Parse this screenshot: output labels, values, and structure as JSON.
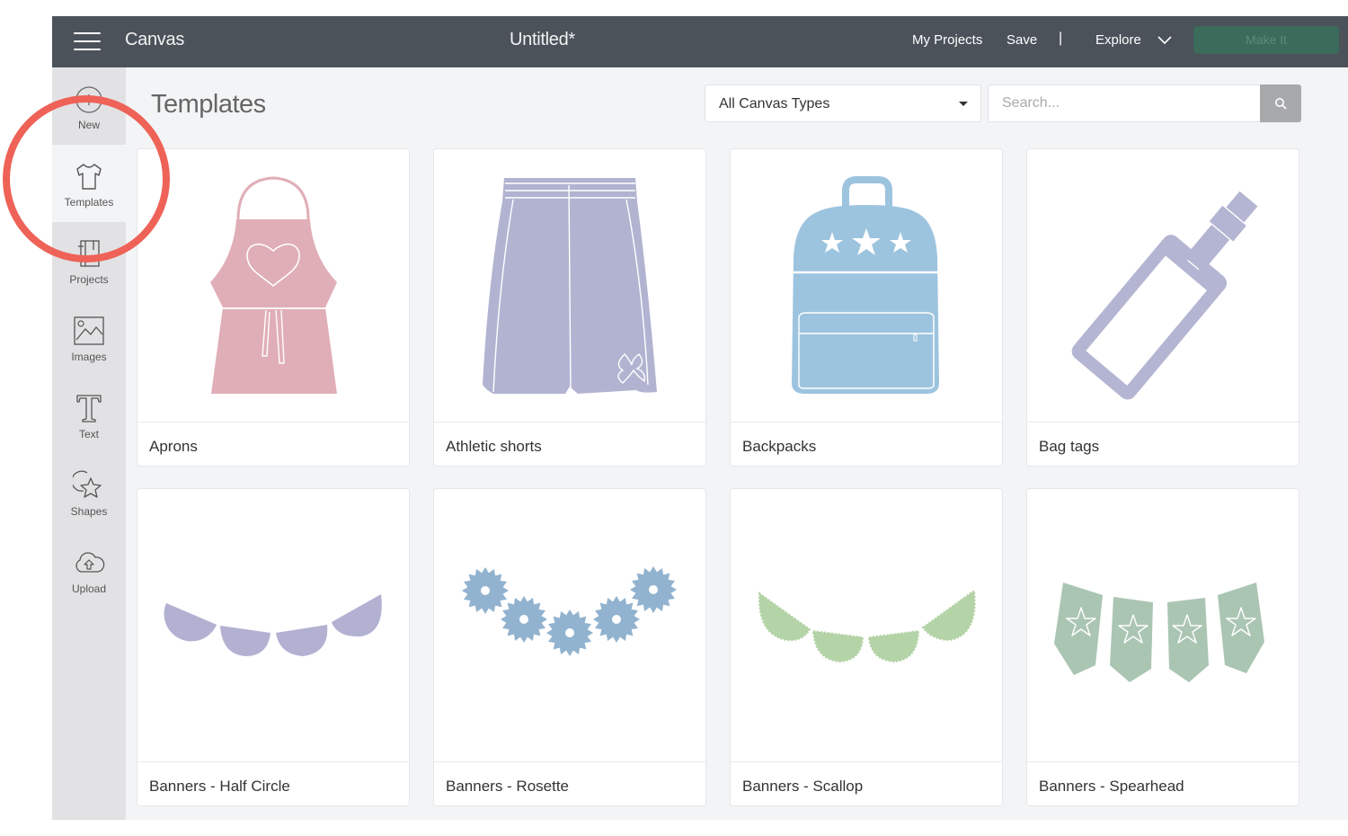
{
  "header": {
    "app_name": "Canvas",
    "document_title": "Untitled*",
    "my_projects_label": "My Projects",
    "save_label": "Save",
    "separator": "|",
    "explore_label": "Explore",
    "make_it_label": "Make It",
    "make_it_color": "#3c6b5b"
  },
  "sidebar": {
    "items": [
      {
        "id": "new",
        "label": "New",
        "icon": "plus-circle-icon",
        "active": false
      },
      {
        "id": "templates",
        "label": "Templates",
        "icon": "tshirt-icon",
        "active": true
      },
      {
        "id": "projects",
        "label": "Projects",
        "icon": "projects-icon",
        "active": false
      },
      {
        "id": "images",
        "label": "Images",
        "icon": "image-icon",
        "active": false
      },
      {
        "id": "text",
        "label": "Text",
        "icon": "text-t-icon",
        "active": false
      },
      {
        "id": "shapes",
        "label": "Shapes",
        "icon": "shapes-icon",
        "active": false
      },
      {
        "id": "upload",
        "label": "Upload",
        "icon": "cloud-upload-icon",
        "active": false
      }
    ]
  },
  "main": {
    "title": "Templates",
    "filter": {
      "selected": "All Canvas Types"
    },
    "search": {
      "placeholder": "Search...",
      "value": ""
    },
    "templates": [
      {
        "label": "Aprons",
        "color": "#e0aeb7"
      },
      {
        "label": "Athletic shorts",
        "color": "#b1b3d1"
      },
      {
        "label": "Backpacks",
        "color": "#9dc4df"
      },
      {
        "label": "Bag tags",
        "color": "#b4b5d2"
      },
      {
        "label": "Banners - Half Circle",
        "color": "#b3b1d2"
      },
      {
        "label": "Banners - Rosette",
        "color": "#92b3cf"
      },
      {
        "label": "Banners - Scallop",
        "color": "#b4d3a6"
      },
      {
        "label": "Banners - Spearhead",
        "color": "#abc5b3"
      }
    ]
  },
  "annotation": {
    "highlight_color": "#ee6257",
    "highlighted_item": "Templates"
  }
}
